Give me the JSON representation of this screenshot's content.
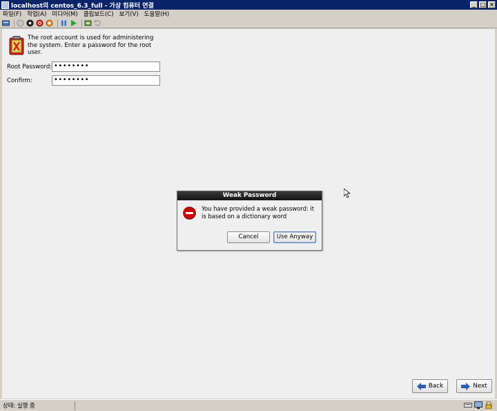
{
  "window": {
    "title": "localhost의 centos_6.3_full - 가상 컴퓨터 연결"
  },
  "menubar": {
    "items": [
      "파일(F)",
      "작업(A)",
      "미디어(M)",
      "클립보드(C)",
      "보기(V)",
      "도움말(H)"
    ]
  },
  "installer": {
    "info_text": "The root account is used for administering the system.  Enter a password for the root user.",
    "root_password_label": "Root Password:",
    "root_password_value": "••••••••",
    "confirm_label": "Confirm:",
    "confirm_value": "••••••••"
  },
  "dialog": {
    "title": "Weak Password",
    "message": "You have provided a weak password: it is based on a dictionary word",
    "cancel_label": "Cancel",
    "use_anyway_label": "Use Anyway"
  },
  "nav": {
    "back_label": "Back",
    "next_label": "Next"
  },
  "statusbar": {
    "text": "상태: 실행 중"
  },
  "colors": {
    "titlebar": "#0a246a",
    "content_bg": "#efefef",
    "dialog_title_bg": "#1a1a1a",
    "error_red": "#cc0000"
  }
}
